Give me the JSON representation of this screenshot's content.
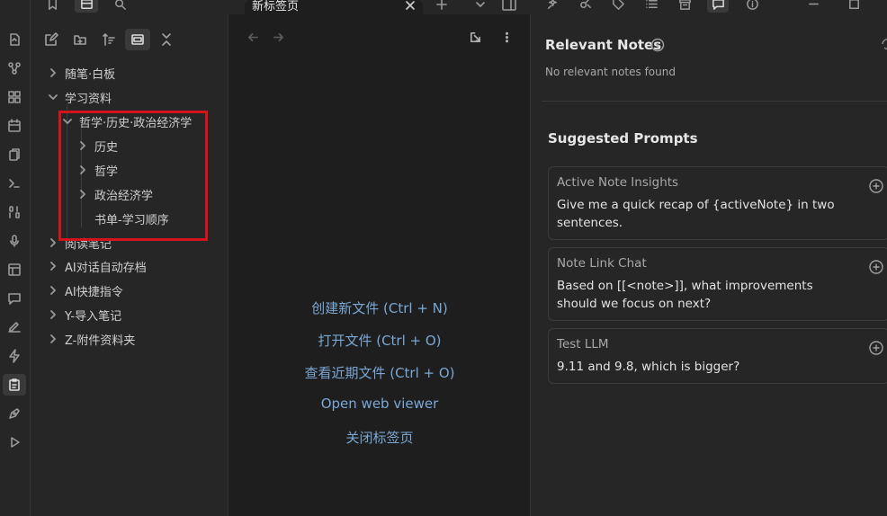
{
  "sidebar_tree": {
    "items": [
      {
        "label": "随笔·白板"
      },
      {
        "label": "学习资料"
      },
      {
        "label": "哲学·历史·政治经济学"
      },
      {
        "label": "历史"
      },
      {
        "label": "哲学"
      },
      {
        "label": "政治经济学"
      },
      {
        "label": "书单-学习顺序"
      },
      {
        "label": "阅读笔记"
      },
      {
        "label": "AI对话自动存档"
      },
      {
        "label": "AI快捷指令"
      },
      {
        "label": "Y-导入笔记"
      },
      {
        "label": "Z-附件资料夹"
      }
    ]
  },
  "tab": {
    "title": "新标签页"
  },
  "empty_state": {
    "actions": [
      "创建新文件 (Ctrl + N)",
      "打开文件 (Ctrl + O)",
      "查看近期文件 (Ctrl + O)",
      "Open web viewer",
      "关闭标签页"
    ]
  },
  "right_panel": {
    "relevant_title": "Relevant Notes",
    "relevant_empty": "No relevant notes found",
    "suggested_title": "Suggested Prompts",
    "prompts": [
      {
        "title": "Active Note Insights",
        "body": "Give me a quick recap of {activeNote} in two sentences."
      },
      {
        "title": "Note Link Chat",
        "body": "Based on [[<note>]], what improvements should we focus on next?"
      },
      {
        "title": "Test LLM",
        "body": "9.11 and 9.8, which is bigger?"
      }
    ]
  },
  "colors": {
    "link": "#7aa7d4",
    "highlight": "#d4131b"
  }
}
